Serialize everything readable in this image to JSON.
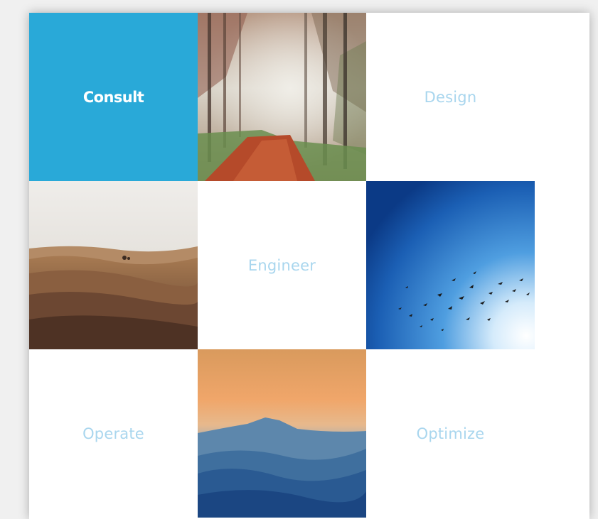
{
  "grid": {
    "tiles": [
      {
        "label": "Consult",
        "state": "active"
      },
      {
        "image": "forest-path-photo"
      },
      {
        "label": "Design"
      },
      {
        "image": "desert-dunes-photo"
      },
      {
        "label": "Engineer"
      },
      {
        "image": "birds-sky-photo"
      },
      {
        "label": "Operate"
      },
      {
        "image": "mountain-sunset-photo"
      },
      {
        "label": "Optimize"
      }
    ]
  },
  "colors": {
    "active_bg": "#29a9d8",
    "active_text": "#ffffff",
    "inactive_text": "#a9d6ee"
  }
}
